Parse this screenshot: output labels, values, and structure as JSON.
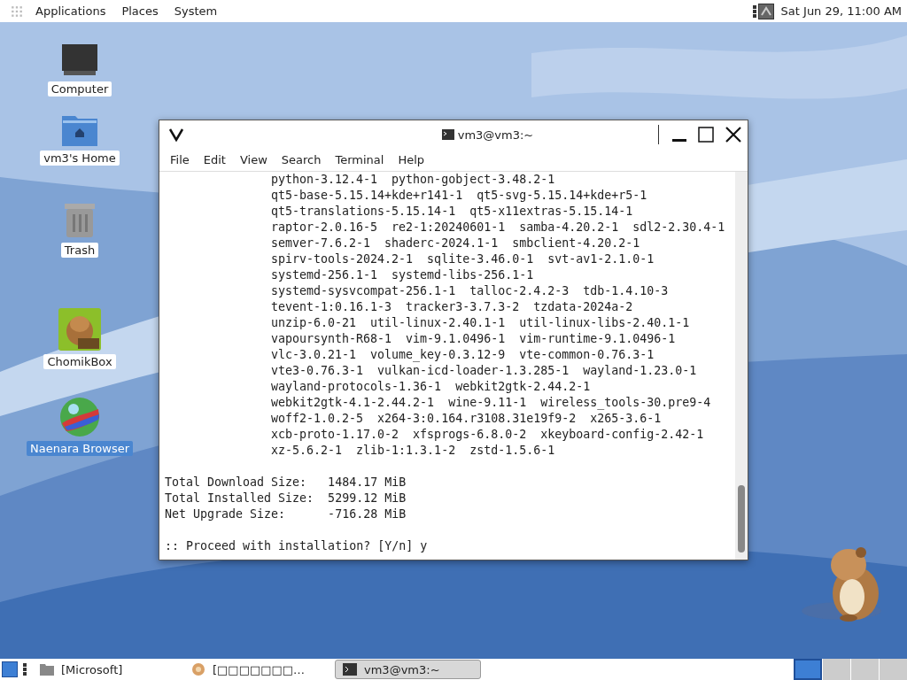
{
  "top_panel": {
    "menus": [
      "Applications",
      "Places",
      "System"
    ],
    "clock": "Sat Jun 29, 11:00 AM"
  },
  "desktop_icons": [
    {
      "kind": "computer",
      "label": "Computer",
      "selected": false
    },
    {
      "kind": "home",
      "label": "vm3's Home",
      "selected": false
    },
    {
      "kind": "trash",
      "label": "Trash",
      "selected": false
    },
    {
      "kind": "chomikbox",
      "label": "ChomikBox",
      "selected": false
    },
    {
      "kind": "browser",
      "label": "Naenara Browser",
      "selected": true
    }
  ],
  "terminal": {
    "title": "vm3@vm3:~",
    "menu": [
      "File",
      "Edit",
      "View",
      "Search",
      "Terminal",
      "Help"
    ],
    "package_lines": [
      "python-3.12.4-1  python-gobject-3.48.2-1",
      "qt5-base-5.15.14+kde+r141-1  qt5-svg-5.15.14+kde+r5-1",
      "qt5-translations-5.15.14-1  qt5-x11extras-5.15.14-1",
      "raptor-2.0.16-5  re2-1:20240601-1  samba-4.20.2-1  sdl2-2.30.4-1",
      "semver-7.6.2-1  shaderc-2024.1-1  smbclient-4.20.2-1",
      "spirv-tools-2024.2-1  sqlite-3.46.0-1  svt-av1-2.1.0-1",
      "systemd-256.1-1  systemd-libs-256.1-1",
      "systemd-sysvcompat-256.1-1  talloc-2.4.2-3  tdb-1.4.10-3",
      "tevent-1:0.16.1-3  tracker3-3.7.3-2  tzdata-2024a-2",
      "unzip-6.0-21  util-linux-2.40.1-1  util-linux-libs-2.40.1-1",
      "vapoursynth-R68-1  vim-9.1.0496-1  vim-runtime-9.1.0496-1",
      "vlc-3.0.21-1  volume_key-0.3.12-9  vte-common-0.76.3-1",
      "vte3-0.76.3-1  vulkan-icd-loader-1.3.285-1  wayland-1.23.0-1",
      "wayland-protocols-1.36-1  webkit2gtk-2.44.2-1",
      "webkit2gtk-4.1-2.44.2-1  wine-9.11-1  wireless_tools-30.pre9-4",
      "woff2-1.0.2-5  x264-3:0.164.r3108.31e19f9-2  x265-3.6-1",
      "xcb-proto-1.17.0-2  xfsprogs-6.8.0-2  xkeyboard-config-2.42-1",
      "xz-5.6.2-1  zlib-1:1.3.1-2  zstd-1.5.6-1"
    ],
    "summary_lines": [
      "Total Download Size:   1484.17 MiB",
      "Total Installed Size:  5299.12 MiB",
      "Net Upgrade Size:      -716.28 MiB"
    ],
    "prompt": ":: Proceed with installation? [Y/n] y"
  },
  "taskbar": {
    "tasks": [
      {
        "kind": "folder",
        "label": "[Microsoft]",
        "selected": false
      },
      {
        "kind": "app",
        "label": "[□□□□□□□…",
        "selected": false
      },
      {
        "kind": "terminal",
        "label": "vm3@vm3:~",
        "selected": true
      }
    ],
    "workspaces": [
      {
        "selected": true
      },
      {
        "selected": false
      },
      {
        "selected": false
      },
      {
        "selected": false
      }
    ]
  }
}
